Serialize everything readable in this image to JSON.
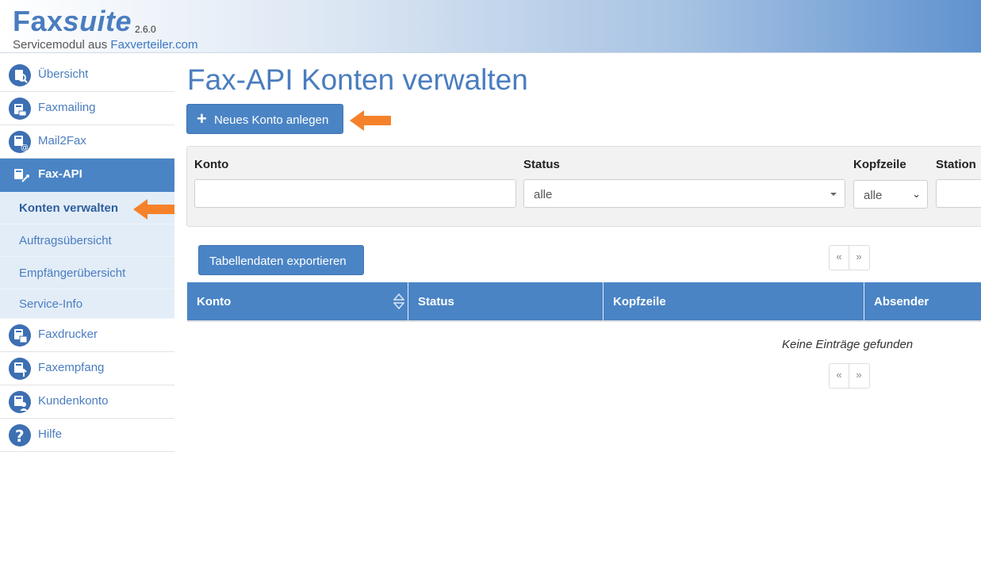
{
  "app": {
    "name_part1": "Fax",
    "name_part2": "suite",
    "version": "2.6.0",
    "subtitle_prefix": "Servicemodul aus ",
    "subtitle_link": "Faxverteiler.com"
  },
  "sidebar": {
    "items": [
      {
        "label": "Übersicht",
        "icon": "overview-icon"
      },
      {
        "label": "Faxmailing",
        "icon": "fax-mailing-icon"
      },
      {
        "label": "Mail2Fax",
        "icon": "mail2fax-icon"
      },
      {
        "label": "Fax-API",
        "icon": "fax-api-icon",
        "active": true
      },
      {
        "label": "Faxdrucker",
        "icon": "fax-printer-icon"
      },
      {
        "label": "Faxempfang",
        "icon": "fax-receive-icon"
      },
      {
        "label": "Kundenkonto",
        "icon": "customer-account-icon"
      },
      {
        "label": "Hilfe",
        "icon": "help-icon"
      }
    ],
    "subitems": [
      {
        "label": "Konten verwalten",
        "current": true
      },
      {
        "label": "Auftragsübersicht"
      },
      {
        "label": "Empfängerübersicht"
      },
      {
        "label": "Service-Info"
      }
    ]
  },
  "main": {
    "title": "Fax-API Konten verwalten",
    "new_button": "Neues Konto anlegen",
    "filters": {
      "konto_label": "Konto",
      "konto_value": "",
      "status_label": "Status",
      "status_value": "alle",
      "kopfzeile_label": "Kopfzeile",
      "kopfzeile_value": "alle",
      "station_label": "Station",
      "station_value": ""
    },
    "export_button": "Tabellendaten exportieren",
    "pager": {
      "prev": "«",
      "next": "»"
    },
    "table": {
      "columns": [
        "Konto",
        "Status",
        "Kopfzeile",
        "Absender"
      ]
    },
    "empty_message": "Keine Einträge gefunden"
  },
  "colors": {
    "accent": "#4a84c5",
    "title": "#4a7dbf",
    "annotation_arrow": "#f5822a"
  }
}
